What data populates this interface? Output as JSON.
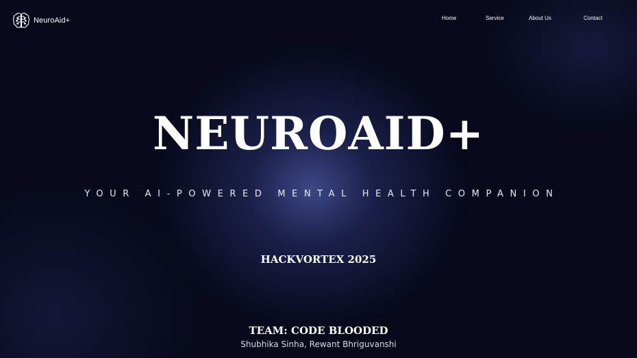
{
  "nav": {
    "logo_text": "NeuroAid+",
    "logo_icon": "brain-icon",
    "links": [
      "Home",
      "Service",
      "About Us",
      "Contact"
    ]
  },
  "hero": {
    "title": "NEUROAID+",
    "tagline": "YOUR AI-POWERED MENTAL HEALTH COMPANION"
  },
  "event": {
    "label": "HACKVORTEX 2025"
  },
  "team": {
    "title": "TEAM: CODE BLOODED",
    "members": "Shubhika Sinha, Rewant Bhriguvanshi"
  },
  "colors": {
    "background": "#07081a",
    "glow": "#4e5caa",
    "text": "#ffffff"
  }
}
